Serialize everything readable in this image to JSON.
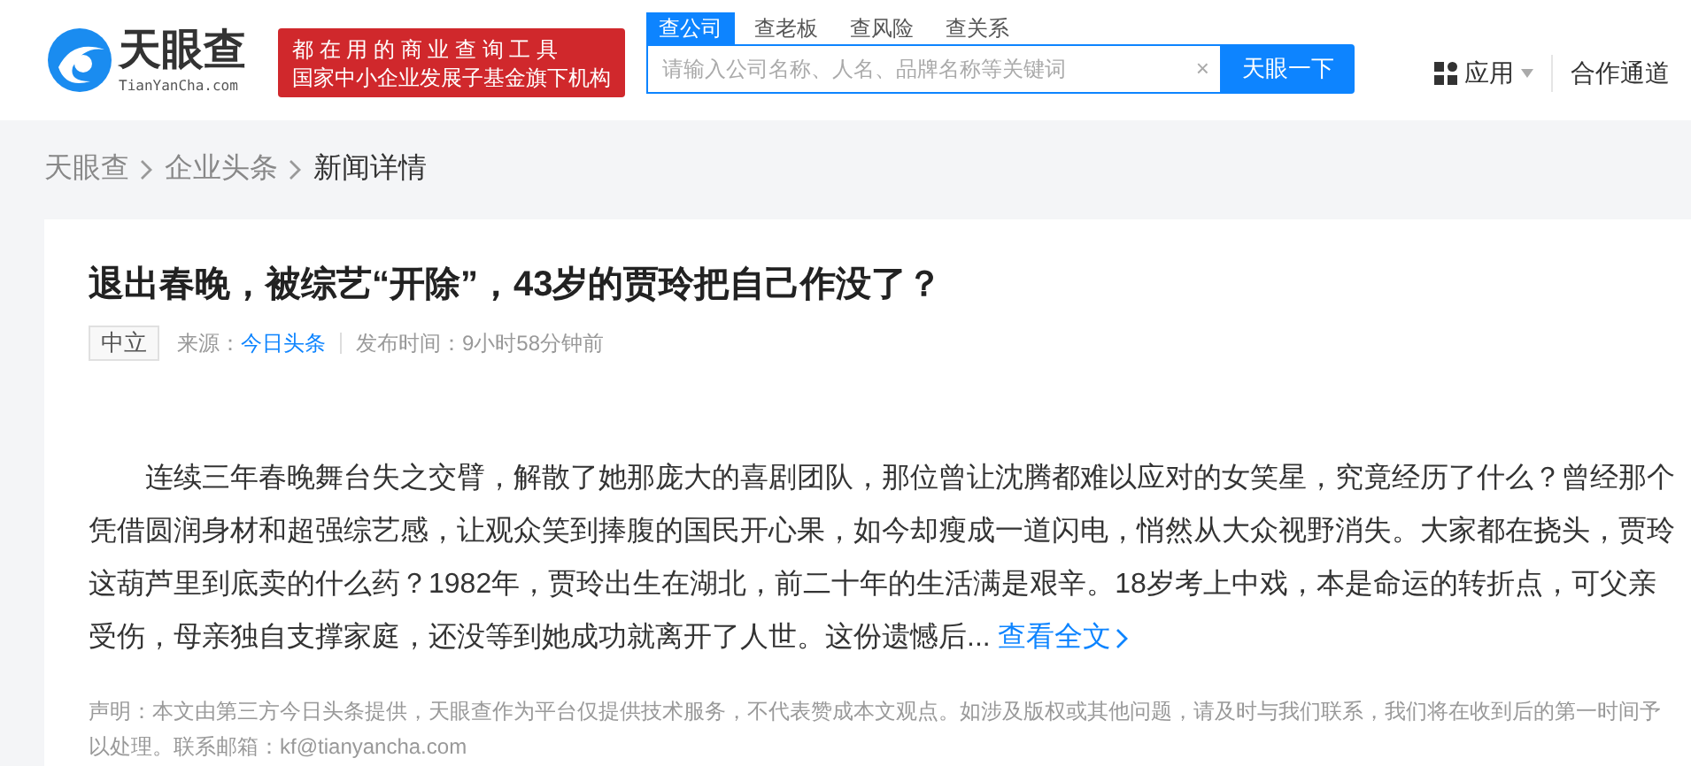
{
  "header": {
    "logo": {
      "name": "天眼查",
      "domain": "TianYanCha.com"
    },
    "slogan": [
      "都 在 用 的 商 业 查 询 工 具",
      "国家中小企业发展子基金旗下机构"
    ],
    "tabs": [
      {
        "label": "查公司",
        "selected": true
      },
      {
        "label": "查老板",
        "selected": false
      },
      {
        "label": "查风险",
        "selected": false
      },
      {
        "label": "查关系",
        "selected": false
      }
    ],
    "search": {
      "placeholder": "请输入公司名称、人名、品牌名称等关键词",
      "clear": "×",
      "button": "天眼一下"
    },
    "nav": [
      "应用",
      "合作通道"
    ]
  },
  "breadcrumb": [
    "天眼查",
    "企业头条",
    "新闻详情"
  ],
  "article": {
    "title": "退出春晚，被综艺“开除”，43岁的贾玲把自己作没了？",
    "sentiment": "中立",
    "source_label": "来源：",
    "source": "今日头条",
    "time_label": "发布时间：",
    "time": "9小时58分钟前",
    "body": "连续三年春晚舞台失之交臂，解散了她那庞大的喜剧团队，那位曾让沈腾都难以应对的女笑星，究竟经历了什么？曾经那个凭借圆润身材和超强综艺感，让观众笑到捧腹的国民开心果，如今却瘦成一道闪电，悄然从大众视野消失。大家都在挠头，贾玲这葫芦里到底卖的什么药？1982年，贾玲出生在湖北，前二十年的生活满是艰辛。18岁考上中戏，本是命运的转折点，可父亲受伤，母亲独自支撑家庭，还没等到她成功就离开了人世。这份遗憾后...",
    "read_more": "查看全文",
    "disclaimer": "声明：本文由第三方今日头条提供，天眼查作为平台仅提供技术服务，不代表赞成本文观点。如涉及版权或其他问题，请及时与我们联系，我们将在收到后的第一时间予以处理。联系邮箱：kf@tianyancha.com"
  }
}
